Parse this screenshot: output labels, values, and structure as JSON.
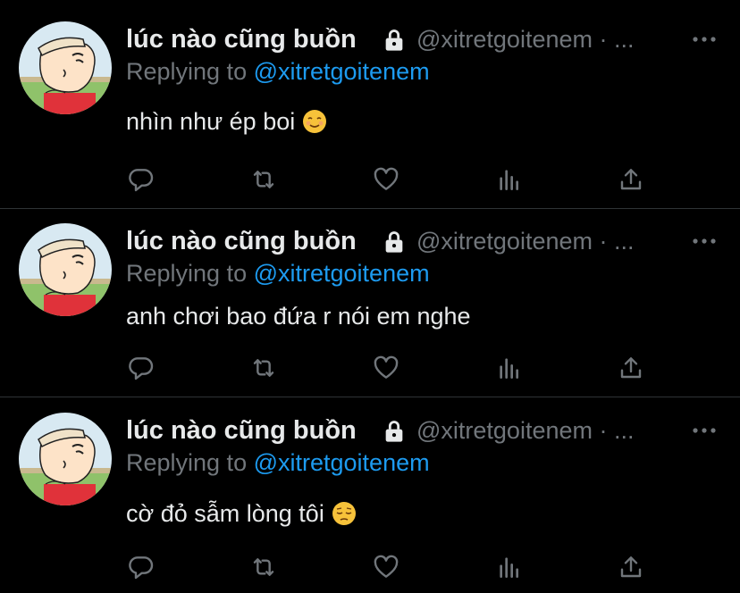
{
  "tweets": [
    {
      "display_name": "lúc nào cũng buồn",
      "handle": "@xitretgoitenem · ...",
      "reply_prefix": "Replying to",
      "reply_handle": "@xitretgoitenem",
      "text": "nhìn như ép boi",
      "emoji": "smiling-face-emoji"
    },
    {
      "display_name": "lúc nào cũng buồn",
      "handle": "@xitretgoitenem · ...",
      "reply_prefix": "Replying to",
      "reply_handle": "@xitretgoitenem",
      "text": "anh chơi bao đứa r nói em nghe",
      "emoji": ""
    },
    {
      "display_name": "lúc nào cũng buồn",
      "handle": "@xitretgoitenem · ...",
      "reply_prefix": "Replying to",
      "reply_handle": "@xitretgoitenem",
      "text": "cờ đỏ sẫm lòng tôi",
      "emoji": "pensive-face-emoji"
    }
  ],
  "icons": {
    "lock": "lock-icon",
    "more": "more-icon",
    "reply": "reply-icon",
    "retweet": "retweet-icon",
    "like": "heart-icon",
    "stats": "analytics-icon",
    "share": "share-icon"
  },
  "colors": {
    "background": "#000000",
    "text": "#e7e9ea",
    "secondary": "#71767b",
    "link": "#1d9bf0",
    "divider": "#2f3336"
  }
}
